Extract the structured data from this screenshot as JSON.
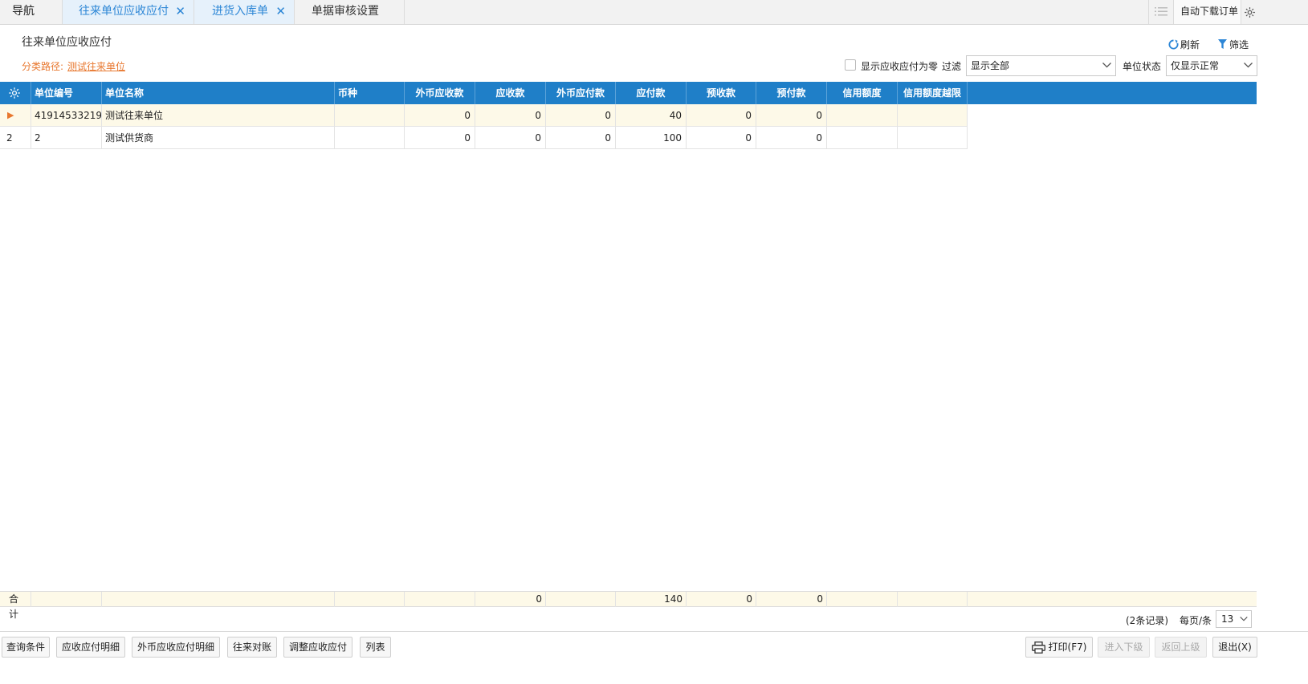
{
  "tabs": {
    "nav": "导航",
    "t1": "往来单位应收应付",
    "t2": "进货入库单",
    "t3": "单据审核设置",
    "auto_download": "自动下载订单"
  },
  "header": {
    "title": "往来单位应收应付",
    "path_label": "分类路径:",
    "path_link": "测试往来单位",
    "refresh": "刷新",
    "filter": "筛选",
    "show_zero": "显示应收应付为零",
    "filter_label": "过滤",
    "filter_value": "显示全部",
    "status_label": "单位状态",
    "status_value": "仅显示正常"
  },
  "columns": [
    "单位编号",
    "单位名称",
    "币种",
    "外币应收款",
    "应收款",
    "外币应付款",
    "应付款",
    "预收款",
    "预付款",
    "信用额度",
    "信用额度越限"
  ],
  "rows": [
    {
      "marker": "▶",
      "code": "41914533219...",
      "name": "测试往来单位",
      "currency": "",
      "fx_recv": "0",
      "recv": "0",
      "fx_pay": "0",
      "pay": "40",
      "pre_recv": "0",
      "pre_pay": "0",
      "credit": "",
      "credit_over": ""
    },
    {
      "marker": "2",
      "code": "2",
      "name": "测试供货商",
      "currency": "",
      "fx_recv": "0",
      "recv": "0",
      "fx_pay": "0",
      "pay": "100",
      "pre_recv": "0",
      "pre_pay": "0",
      "credit": "",
      "credit_over": ""
    }
  ],
  "sum": {
    "label": "合计",
    "recv": "0",
    "pay": "140",
    "pre_recv": "0",
    "pre_pay": "0"
  },
  "pager": {
    "records": "(2条记录)",
    "per_page_label": "每页/条",
    "per_page": "13"
  },
  "buttons": {
    "query": "查询条件",
    "detail": "应收应付明细",
    "fx_detail": "外币应收应付明细",
    "reconcile": "往来对账",
    "adjust": "调整应收应付",
    "list": "列表",
    "print": "打印(F7)",
    "down": "进入下级",
    "up": "返回上级",
    "exit": "退出(X)"
  }
}
